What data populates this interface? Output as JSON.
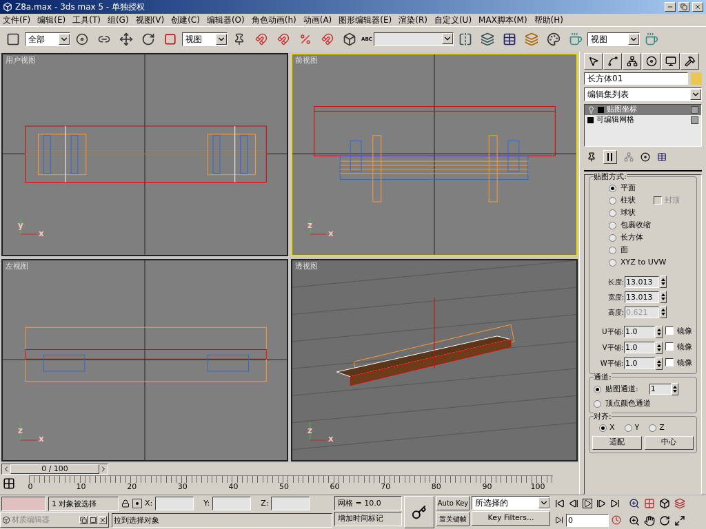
{
  "window": {
    "title": "Z8a.max - 3ds max 5 - 单独授权"
  },
  "menu": [
    "文件(F)",
    "编辑(E)",
    "工具(T)",
    "组(G)",
    "视图(V)",
    "创建(C)",
    "编辑器(O)",
    "角色动画(h)",
    "动画(A)",
    "图形编辑器(E)",
    "渲染(R)",
    "自定义(U)",
    "MAX脚本(M)",
    "帮助(H)"
  ],
  "toolbar": {
    "selection_filter": "全部",
    "coord_system": "视图",
    "render_view": "视图",
    "abc_label": "ABC"
  },
  "viewports": [
    {
      "label": "用户视图",
      "kind": "top",
      "active": false,
      "triad": [
        "y",
        "x"
      ]
    },
    {
      "label": "前视图",
      "kind": "front",
      "active": true,
      "triad": [
        "z",
        "x"
      ]
    },
    {
      "label": "左视图",
      "kind": "left",
      "active": false,
      "triad": [
        "z",
        "x"
      ]
    },
    {
      "label": "透视图",
      "kind": "persp",
      "active": false,
      "triad": [
        "z",
        "x"
      ]
    }
  ],
  "frame_slider": {
    "label": "0 / 100"
  },
  "timeline": [
    "0",
    "10",
    "20",
    "30",
    "40",
    "50",
    "60",
    "70",
    "80",
    "90",
    "100"
  ],
  "command_panel": {
    "object_name": "长方体01",
    "modifier_list": "编辑集列表",
    "stack": [
      {
        "label": "贴图坐标",
        "selected": true
      },
      {
        "label": "可编辑网格",
        "selected": false
      }
    ],
    "mapping": {
      "title": "贴图方式:",
      "options": [
        {
          "label": "平面",
          "selected": true
        },
        {
          "label": "柱状",
          "selected": false
        },
        {
          "label": "球状",
          "selected": false
        },
        {
          "label": "包裹收缩",
          "selected": false
        },
        {
          "label": "长方体",
          "selected": false
        },
        {
          "label": "面",
          "selected": false
        },
        {
          "label": "XYZ to UVW",
          "selected": false
        }
      ],
      "cap": {
        "label": "封顶",
        "checked": false,
        "disabled": true
      },
      "dims": [
        {
          "label": "长度:",
          "value": "13.013",
          "disabled": false
        },
        {
          "label": "宽度:",
          "value": "13.013",
          "disabled": false
        },
        {
          "label": "高度:",
          "value": "0.621",
          "disabled": true
        }
      ],
      "tiles": [
        {
          "label": "U平铺:",
          "value": "1.0",
          "mirror_label": "镜像",
          "mirror": false
        },
        {
          "label": "V平铺:",
          "value": "1.0",
          "mirror_label": "镜像",
          "mirror": false
        },
        {
          "label": "W平铺:",
          "value": "1.0",
          "mirror_label": "镜像",
          "mirror": false
        }
      ]
    },
    "channel": {
      "title": "通道:",
      "options": [
        {
          "label": "贴图通道:",
          "selected": true
        },
        {
          "label": "顶点颜色通道",
          "selected": false
        }
      ],
      "value": "1"
    },
    "alignment": {
      "title": "对齐:",
      "options": [
        {
          "label": "X",
          "selected": true
        },
        {
          "label": "Y",
          "selected": false
        },
        {
          "label": "Z",
          "selected": false
        }
      ],
      "buttons": [
        "适配",
        "中心"
      ]
    }
  },
  "status": {
    "selection": "1 对象被选择",
    "x_label": "X:",
    "y_label": "Y:",
    "z_label": "Z:",
    "grid": "网格 = 10.0",
    "prompt": "拉到选择对象",
    "add_time_tag": "增加时间标记",
    "auto_key": "Auto Key",
    "set_key": "置关键帧",
    "key_mode": "所选择的",
    "key_filters": "Key Filters...",
    "frame": "0"
  },
  "material_editor": {
    "title": "材质编辑器"
  }
}
